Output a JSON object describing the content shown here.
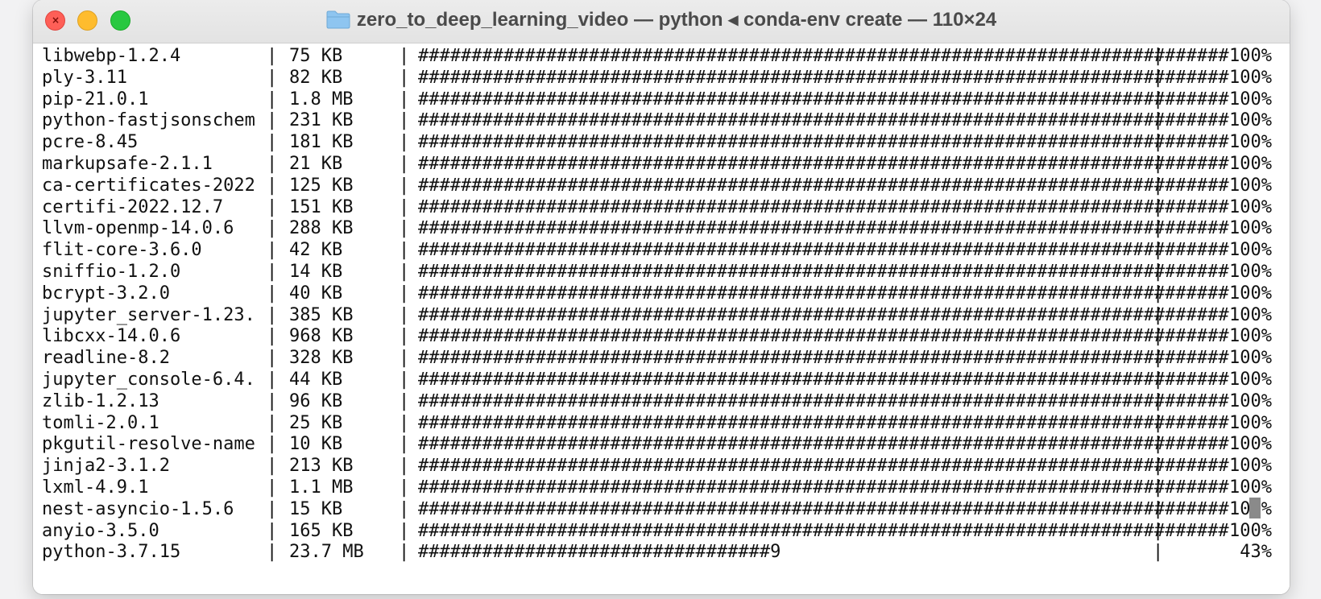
{
  "window": {
    "title": "zero_to_deep_learning_video — python ◂ conda-env create — 110×24",
    "close_glyph": "×"
  },
  "terminal": {
    "rows": [
      {
        "name": "libwebp-1.2.4",
        "size": "75 KB",
        "bar": "############################################################################",
        "percent": "100%"
      },
      {
        "name": "ply-3.11",
        "size": "82 KB",
        "bar": "############################################################################",
        "percent": "100%"
      },
      {
        "name": "pip-21.0.1",
        "size": "1.8 MB",
        "bar": "############################################################################",
        "percent": "100%"
      },
      {
        "name": "python-fastjsonschem",
        "size": "231 KB",
        "bar": "############################################################################",
        "percent": "100%"
      },
      {
        "name": "pcre-8.45",
        "size": "181 KB",
        "bar": "############################################################################",
        "percent": "100%"
      },
      {
        "name": "markupsafe-2.1.1",
        "size": "21 KB",
        "bar": "############################################################################",
        "percent": "100%"
      },
      {
        "name": "ca-certificates-2022",
        "size": "125 KB",
        "bar": "############################################################################",
        "percent": "100%"
      },
      {
        "name": "certifi-2022.12.7",
        "size": "151 KB",
        "bar": "############################################################################",
        "percent": "100%"
      },
      {
        "name": "llvm-openmp-14.0.6",
        "size": "288 KB",
        "bar": "############################################################################",
        "percent": "100%"
      },
      {
        "name": "flit-core-3.6.0",
        "size": "42 KB",
        "bar": "############################################################################",
        "percent": "100%"
      },
      {
        "name": "sniffio-1.2.0",
        "size": "14 KB",
        "bar": "############################################################################",
        "percent": "100%"
      },
      {
        "name": "bcrypt-3.2.0",
        "size": "40 KB",
        "bar": "############################################################################",
        "percent": "100%"
      },
      {
        "name": "jupyter_server-1.23.",
        "size": "385 KB",
        "bar": "############################################################################",
        "percent": "100%"
      },
      {
        "name": "libcxx-14.0.6",
        "size": "968 KB",
        "bar": "############################################################################",
        "percent": "100%"
      },
      {
        "name": "readline-8.2",
        "size": "328 KB",
        "bar": "############################################################################",
        "percent": "100%"
      },
      {
        "name": "jupyter_console-6.4.",
        "size": "44 KB",
        "bar": "############################################################################",
        "percent": "100%"
      },
      {
        "name": "zlib-1.2.13",
        "size": "96 KB",
        "bar": "############################################################################",
        "percent": "100%"
      },
      {
        "name": "tomli-2.0.1",
        "size": "25 KB",
        "bar": "############################################################################",
        "percent": "100%"
      },
      {
        "name": "pkgutil-resolve-name",
        "size": "10 KB",
        "bar": "############################################################################",
        "percent": "100%"
      },
      {
        "name": "jinja2-3.1.2",
        "size": "213 KB",
        "bar": "############################################################################",
        "percent": "100%"
      },
      {
        "name": "lxml-4.9.1",
        "size": "1.1 MB",
        "bar": "############################################################################",
        "percent": "100%"
      },
      {
        "name": "nest-asyncio-1.5.6",
        "size": "15 KB",
        "bar": "############################################################################",
        "percent": "100%"
      },
      {
        "name": "anyio-3.5.0",
        "size": "165 KB",
        "bar": "############################################################################",
        "percent": "100%"
      },
      {
        "name": "python-3.7.15",
        "size": "23.7 MB",
        "bar": "#################################9",
        "percent": "43%"
      }
    ],
    "separator": "|"
  },
  "colors": {
    "close": "#fe5f57",
    "minimize": "#febc2e",
    "maximize": "#28c840",
    "folder": "#8ec5f0"
  }
}
